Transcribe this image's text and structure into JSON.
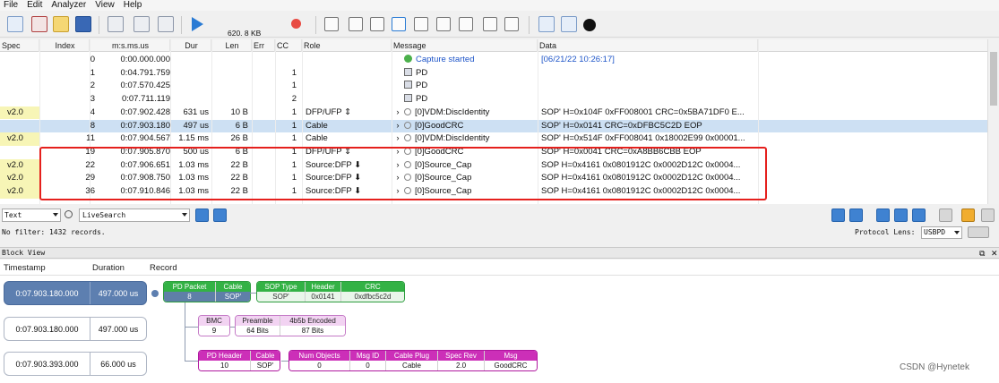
{
  "menu": [
    "File",
    "Edit",
    "Analyzer",
    "View",
    "Help"
  ],
  "toolbar": {
    "buffer_size": "620. 8 KB",
    "icons": [
      "new-file-icon",
      "delete-icon",
      "open-folder-icon",
      "save-icon",
      "settings-icon",
      "config-icon",
      "device-icon",
      "play-icon",
      "record-icon",
      "view-icon",
      "view-icon",
      "view-icon",
      "view-icon",
      "view-icon",
      "view-icon",
      "view-icon",
      "hz-icon",
      "view-icon",
      "export-icon",
      "export-icon",
      "bomb-icon"
    ]
  },
  "table": {
    "columns": [
      "Spec",
      "Index",
      "m:s.ms.us",
      "Dur",
      "Len",
      "Err",
      "CC",
      "Role",
      "Message",
      "Data"
    ],
    "rows": [
      {
        "spec": "",
        "index": "0",
        "time": "0:00.000.000",
        "dur": "",
        "len": "",
        "err": "",
        "cc": "",
        "role": "",
        "message": "Capture started",
        "data": "[06/21/22 10:26:17]",
        "kind": "capture"
      },
      {
        "spec": "",
        "index": "1",
        "time": "0:04.791.759",
        "dur": "",
        "len": "",
        "err": "",
        "cc": "1",
        "role": "",
        "message": "PD",
        "data": "",
        "kind": "pd"
      },
      {
        "spec": "",
        "index": "2",
        "time": "0:07.570.425",
        "dur": "",
        "len": "",
        "err": "",
        "cc": "1",
        "role": "",
        "message": "PD",
        "data": "",
        "kind": "pd"
      },
      {
        "spec": "",
        "index": "3",
        "time": "0:07.711.119",
        "dur": "",
        "len": "",
        "err": "",
        "cc": "2",
        "role": "",
        "message": "PD",
        "data": "",
        "kind": "pd"
      },
      {
        "spec": "v2.0",
        "index": "4",
        "time": "0:07.902.428",
        "dur": "631 us",
        "len": "10 B",
        "err": "",
        "cc": "1",
        "role": "DFP/UFP ⇕",
        "message": "[0]VDM:DiscIdentity",
        "data": "SOP' H=0x104F 0xFF008001 CRC=0x5BA71DF0 E...",
        "kind": "msg"
      },
      {
        "spec": "",
        "index": "8",
        "time": "0:07.903.180",
        "dur": "497 us",
        "len": "6 B",
        "err": "",
        "cc": "1",
        "role": "Cable",
        "message": "[0]GoodCRC",
        "data": "SOP' H=0x0141 CRC=0xDFBC5C2D EOP",
        "kind": "msg",
        "selected": true
      },
      {
        "spec": "v2.0",
        "index": "11",
        "time": "0:07.904.567",
        "dur": "1.15 ms",
        "len": "26 B",
        "err": "",
        "cc": "1",
        "role": "Cable",
        "message": "[0]VDM:DiscIdentity",
        "data": "SOP' H=0x514F 0xFF008041 0x18002E99 0x00001...",
        "kind": "msg"
      },
      {
        "spec": "",
        "index": "19",
        "time": "0:07.905.870",
        "dur": "500 us",
        "len": "6 B",
        "err": "",
        "cc": "1",
        "role": "DFP/UFP ⇕",
        "message": "[0]GoodCRC",
        "data": "SOP' H=0x0041 CRC=0xA8BB6CBB EOP",
        "kind": "msg"
      },
      {
        "spec": "v2.0",
        "index": "22",
        "time": "0:07.906.651",
        "dur": "1.03 ms",
        "len": "22 B",
        "err": "",
        "cc": "1",
        "role": "Source:DFP ⬇",
        "message": "[0]Source_Cap",
        "data": "SOP H=0x4161 0x0801912C 0x0002D12C 0x0004...",
        "kind": "msg"
      },
      {
        "spec": "v2.0",
        "index": "29",
        "time": "0:07.908.750",
        "dur": "1.03 ms",
        "len": "22 B",
        "err": "",
        "cc": "1",
        "role": "Source:DFP ⬇",
        "message": "[0]Source_Cap",
        "data": "SOP H=0x4161 0x0801912C 0x0002D12C 0x0004...",
        "kind": "msg"
      },
      {
        "spec": "v2.0",
        "index": "36",
        "time": "0:07.910.846",
        "dur": "1.03 ms",
        "len": "22 B",
        "err": "",
        "cc": "1",
        "role": "Source:DFP ⬇",
        "message": "[0]Source_Cap",
        "data": "SOP H=0x4161 0x0801912C 0x0002D12C 0x0004...",
        "kind": "msg"
      }
    ]
  },
  "filter": {
    "view_select": "Text",
    "live_search": "LiveSearch",
    "status": "No filter: 1432 records.",
    "protocol_label": "Protocol Lens:",
    "protocol_value": "USBPD"
  },
  "block_view": {
    "title": "Block View",
    "headers": {
      "timestamp": "Timestamp",
      "duration": "Duration",
      "record": "Record"
    },
    "records": [
      {
        "timestamp": "0:07.903.180.000",
        "duration": "497.000 us",
        "active": true
      },
      {
        "timestamp": "0:07.903.180.000",
        "duration": "497.000 us",
        "active": false
      },
      {
        "timestamp": "0:07.903.393.000",
        "duration": "66.000 us",
        "active": false
      }
    ],
    "pd_packet": [
      {
        "h": "PD Packet",
        "v": "8"
      },
      {
        "h": "Cable",
        "v": "SOP'"
      }
    ],
    "sop_fields": [
      {
        "h": "SOP Type",
        "v": "SOP'"
      },
      {
        "h": "Header",
        "v": "0x0141"
      },
      {
        "h": "CRC",
        "v": "0xdfbc5c2d"
      }
    ],
    "bmc": [
      {
        "h": "BMC",
        "v": "9"
      }
    ],
    "encoded": [
      {
        "h": "Preamble",
        "v": "64 Bits"
      },
      {
        "h": "4b5b Encoded",
        "v": "87 Bits"
      }
    ],
    "pd_header": [
      {
        "h": "PD Header",
        "v": "10"
      },
      {
        "h": "Cable",
        "v": "SOP'"
      }
    ],
    "header_fields": [
      {
        "h": "Num Objects",
        "v": "0"
      },
      {
        "h": "Msg ID",
        "v": "0"
      },
      {
        "h": "Cable Plug",
        "v": "Cable"
      },
      {
        "h": "Spec Rev",
        "v": "2.0"
      },
      {
        "h": "Msg",
        "v": "GoodCRC"
      }
    ]
  },
  "watermark": "CSDN @Hynetek"
}
